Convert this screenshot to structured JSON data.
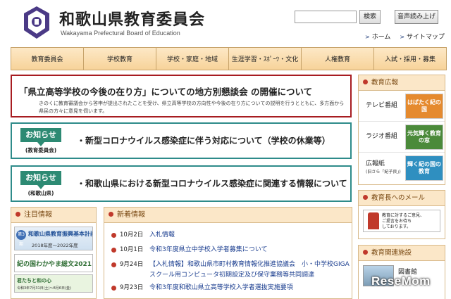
{
  "header": {
    "title": "和歌山県教育委員会",
    "subtitle": "Wakayama Prefectural Board of Education",
    "search_button": "検索",
    "voice_button": "音声読み上げ",
    "links": [
      "ホーム",
      "サイトマップ"
    ]
  },
  "nav": [
    "教育委員会",
    "学校教育",
    "学校・家庭・地域",
    "生涯学習・ｽﾎﾟｰﾂ・文化",
    "人権教育",
    "入試・採用・募集"
  ],
  "announcement": {
    "title": "「県立高等学校の今後の在り方」についての地方別懇談会 の開催について",
    "body": "きのくに教育審議会から答申が提出されたことを受け、県立高等学校の方向性や今後の在り方についての説明を行うとともに、多方面から県民の方々に意見を伺います。"
  },
  "notices": [
    {
      "badge": "お知らせ",
      "source": "(教育委員会)",
      "text": "・新型コロナウイルス感染症に伴う対応について（学校の休業等）"
    },
    {
      "badge": "お知らせ",
      "source": "(和歌山県)",
      "text": "・和歌山県における新型コロナウイルス感染症に関連する情報について"
    }
  ],
  "side": {
    "pr_title": "教育広報",
    "pr_items": [
      {
        "label": "テレビ番組",
        "sub": "",
        "banner": "はばたく紀の国",
        "color": "#e58a2e"
      },
      {
        "label": "ラジオ番組",
        "sub": "",
        "banner": "元気輝く教育の窓",
        "color": "#4b8a3a"
      },
      {
        "label": "広報紙",
        "sub": "(旧さら「紀子良」)",
        "banner": "輝く紀の国の教育",
        "color": "#2f8fc0"
      }
    ],
    "mail_title": "教育長へのメール",
    "mail_text": [
      "教育に対するご意見、",
      "ご提言をお待ち",
      "しております。"
    ],
    "facility_title": "教育関連施設",
    "facility_label": "図書館"
  },
  "focus": {
    "title": "注目情報",
    "banner1_badge": "第3期",
    "banner1_title": "和歌山県教育振興基本計画",
    "banner1_sub": "2018年度～2022年度",
    "banner2_title": "紀の国わかやま総文2021",
    "banner3_title": "君たちと和の心",
    "banner3_sub": "令和3年7月31日(土)～8月6日(金)"
  },
  "news": {
    "title": "新着情報",
    "items": [
      {
        "date": "10月2日",
        "title": "入札情報"
      },
      {
        "date": "10月1日",
        "title": "令和3年度県立中学校入学者募集について"
      },
      {
        "date": "9月24日",
        "title": "【入札情報】和歌山県市町村教育情報化推進協議会　小・中学校GIGAスクール用コンピュータ初期設定及び保守業務等共同調達"
      },
      {
        "date": "9月23日",
        "title": "令和3年度和歌山県立高等学校入学者選抜実施要項"
      }
    ]
  },
  "watermark": "ReseMom"
}
